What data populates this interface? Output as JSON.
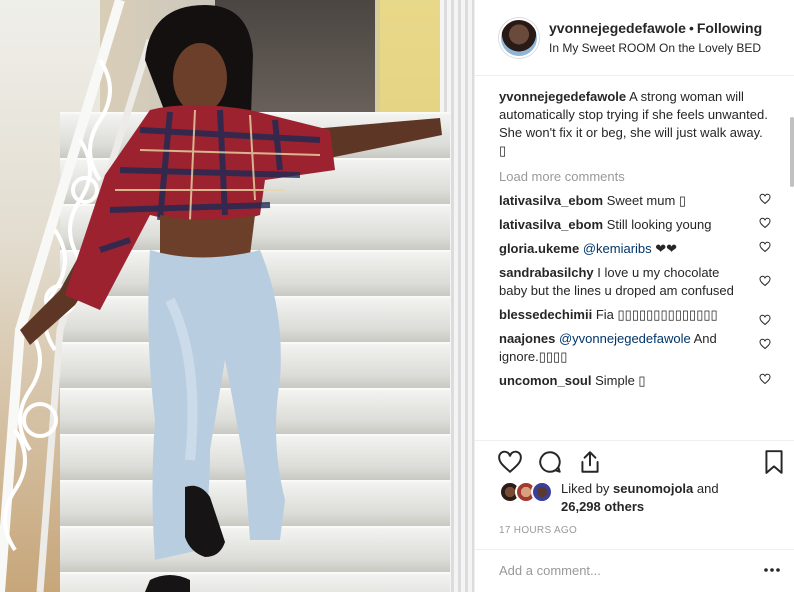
{
  "post": {
    "photo_alt": "",
    "author": {
      "username": "yvonnejegedefawole",
      "separator": "•",
      "follow_label": "Following",
      "location": "In My Sweet ROOM On the Lovely BED"
    },
    "caption": {
      "username": "yvonnejegedefawole",
      "text": "A strong woman will automatically stop trying if she feels unwanted. She won't fix it or beg, she will just walk away.",
      "extra": "▯"
    },
    "load_more_label": "Load more comments",
    "comments": [
      {
        "username": "lativasilva_ebom",
        "mention": "",
        "text": "Sweet mum ▯"
      },
      {
        "username": "lativasilva_ebom",
        "mention": "",
        "text": "Still looking young"
      },
      {
        "username": "gloria.ukeme",
        "mention": "@kemiaribs",
        "text": "❤❤"
      },
      {
        "username": "sandrabasilchy",
        "mention": "",
        "text": "I love u my chocolate baby but the lines u droped am confused"
      },
      {
        "username": "blessedechimii",
        "mention": "",
        "text": "Fia ▯▯▯▯▯▯▯▯▯▯▯▯▯▯"
      },
      {
        "username": "naajones",
        "mention": "@yvonnejegedefawole",
        "text": "And ignore.▯▯▯▯"
      },
      {
        "username": "uncomon_soul",
        "mention": "",
        "text": "Simple ▯"
      }
    ],
    "likes": {
      "prefix": "Liked by",
      "liker": "seunomojola",
      "joiner": "and",
      "count": "26,298 others"
    },
    "timestamp": "17 HOURS AGO",
    "add_comment_placeholder": "Add a comment...",
    "icons": {
      "like": "heart-outline-icon",
      "comment": "speech-bubble-icon",
      "share": "share-icon",
      "save": "bookmark-icon",
      "more": "ellipsis-icon"
    },
    "colors": {
      "text": "#262626",
      "muted": "#999999",
      "mention": "#003569",
      "divider": "#efefef"
    }
  }
}
